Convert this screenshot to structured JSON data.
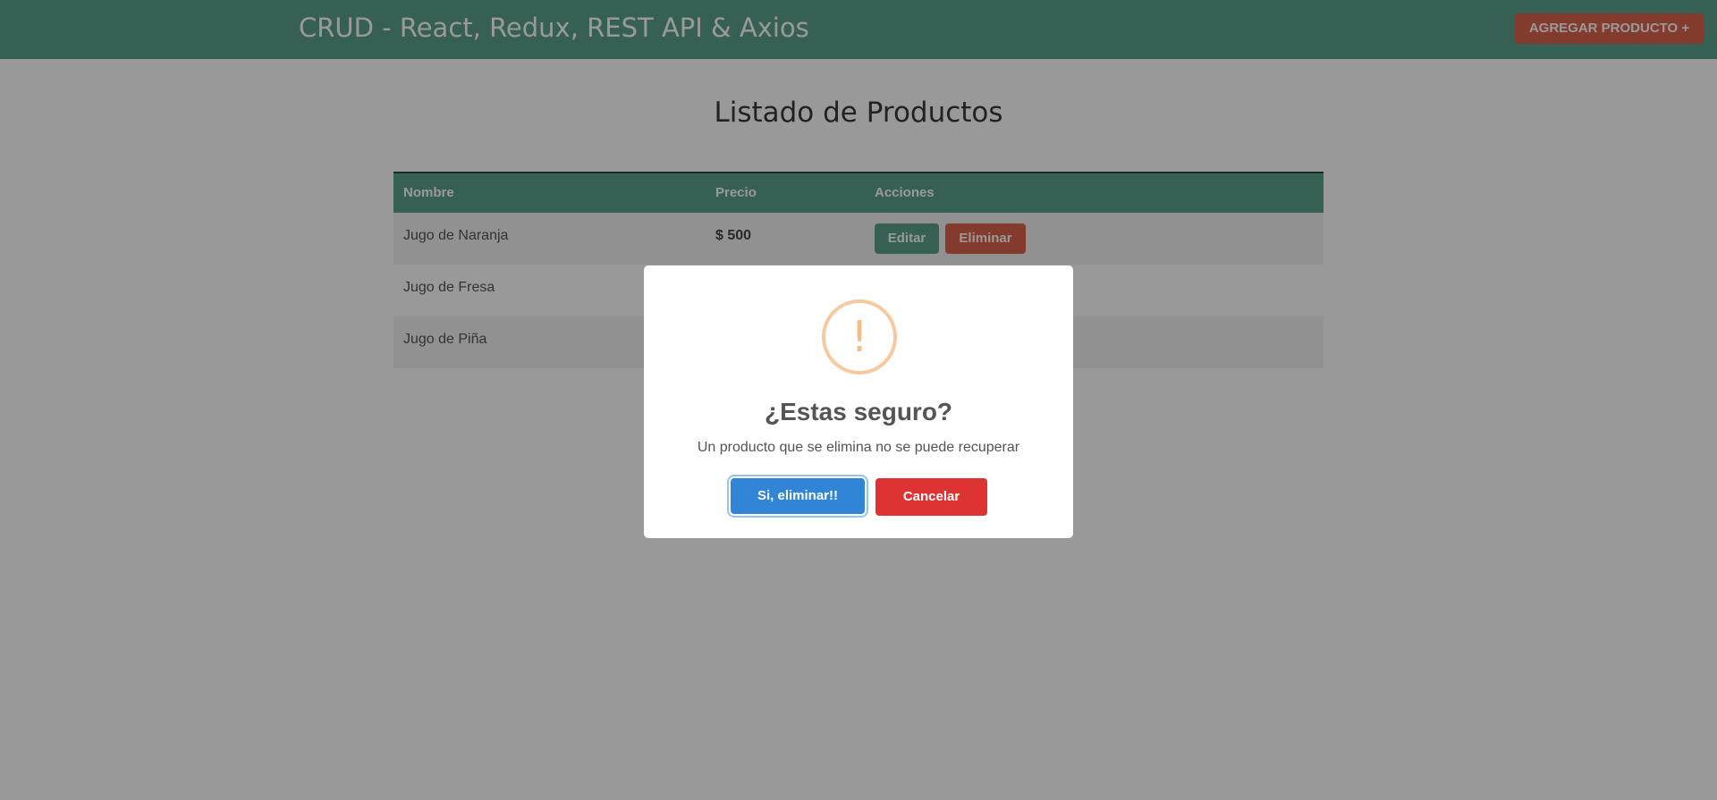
{
  "navbar": {
    "brand": "CRUD - React, Redux, REST API & Axios",
    "add_button": "AGREGAR PRODUCTO +"
  },
  "page": {
    "heading": "Listado de Productos"
  },
  "table": {
    "headers": [
      "Nombre",
      "Precio",
      "Acciones"
    ],
    "rows": [
      {
        "name": "Jugo de Naranja",
        "price": "$ 500",
        "edit": "Editar",
        "delete": "Eliminar"
      },
      {
        "name": "Jugo de Fresa"
      },
      {
        "name": "Jugo de Piña"
      }
    ]
  },
  "modal": {
    "icon": "exclamation-icon",
    "icon_glyph": "!",
    "title": "¿Estas seguro?",
    "text": "Un producto que se elimina no se puede recuperar",
    "confirm": "Si, eliminar!!",
    "cancel": "Cancelar"
  },
  "colors": {
    "primary_green": "#5ba08a",
    "danger_orange": "#d9634a",
    "confirm_blue": "#3085d6",
    "cancel_red": "#dd3333",
    "warning_icon": "#f8bb86"
  }
}
